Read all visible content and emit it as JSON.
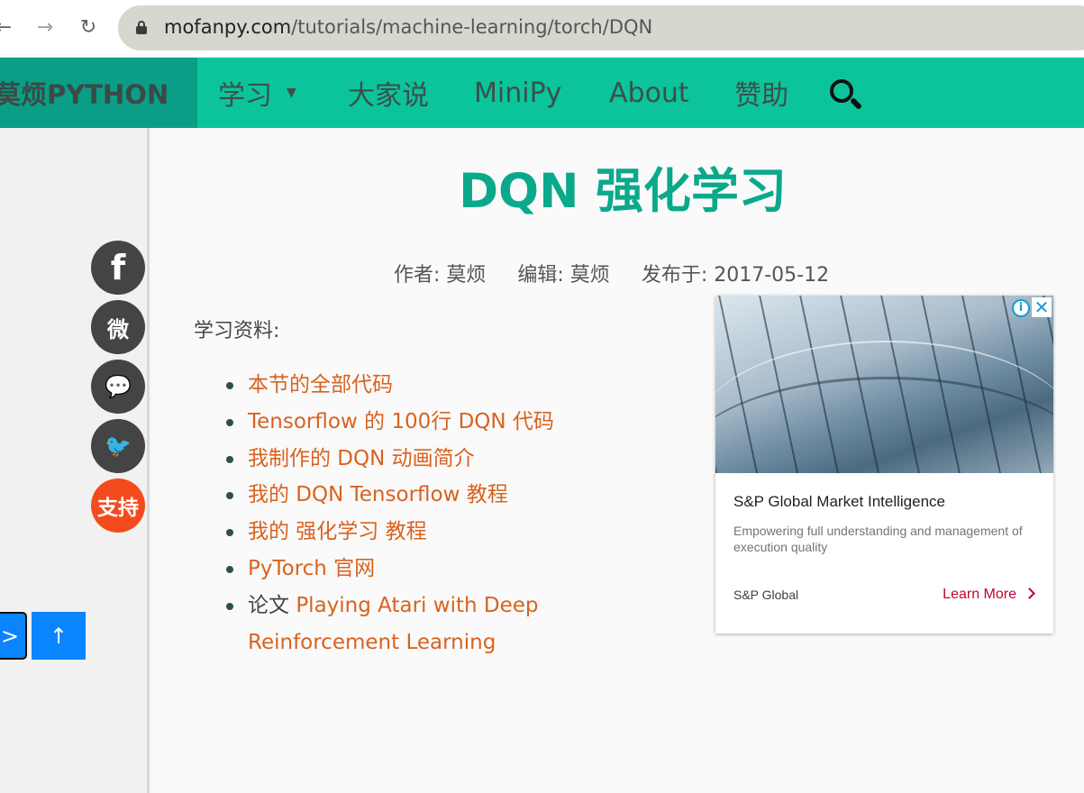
{
  "browser": {
    "url_host": "mofanpy.com",
    "url_path": "/tutorials/machine-learning/torch/DQN",
    "back_glyph": "←",
    "forward_glyph": "→",
    "reload_glyph": "↻"
  },
  "nav": {
    "brand": "莫烦PYTHON",
    "items": [
      {
        "label": "学习",
        "has_caret": true
      },
      {
        "label": "大家说"
      },
      {
        "label": "MiniPy"
      },
      {
        "label": "About"
      },
      {
        "label": "赞助"
      }
    ],
    "caret_glyph": "▼",
    "colors": {
      "bar": "#0bc49b",
      "brand_bg": "#0a9e87",
      "text": "#3c4f4b"
    }
  },
  "sidebar": {
    "social": [
      {
        "icon": "facebook-icon",
        "glyph": "f"
      },
      {
        "icon": "weibo-icon",
        "glyph": "微"
      },
      {
        "icon": "wechat-icon",
        "glyph": "💬"
      },
      {
        "icon": "twitter-icon",
        "glyph": "🐦"
      },
      {
        "icon": "support-icon",
        "glyph": "支持"
      }
    ],
    "pager": {
      "next_label": ">",
      "top_label": "↑"
    }
  },
  "article": {
    "title": "DQN 强化学习",
    "meta": {
      "author": "作者: 莫烦",
      "editor": "编辑: 莫烦",
      "published": "发布于: 2017-05-12"
    },
    "resources_label": "学习资料:",
    "resources": [
      {
        "prefix": "",
        "link": "本节的全部代码"
      },
      {
        "prefix": "",
        "link": "Tensorflow 的 100行 DQN 代码"
      },
      {
        "prefix": "",
        "link": "我制作的 DQN 动画简介"
      },
      {
        "prefix": "",
        "link": "我的 DQN Tensorflow 教程"
      },
      {
        "prefix": "",
        "link": "我的 强化学习 教程"
      },
      {
        "prefix": "",
        "link": "PyTorch 官网"
      },
      {
        "prefix": "论文 ",
        "link": "Playing Atari with Deep",
        "link_line2": "Reinforcement Learning"
      }
    ],
    "colors": {
      "title": "#0aa98b",
      "link": "#d9621f"
    }
  },
  "ad": {
    "headline": "S&P Global Market Intelligence",
    "description": "Empowering full understanding and management of execution quality",
    "advertiser": "S&P Global",
    "cta": "Learn More",
    "info_glyph": "i",
    "close_glyph": "✕"
  }
}
